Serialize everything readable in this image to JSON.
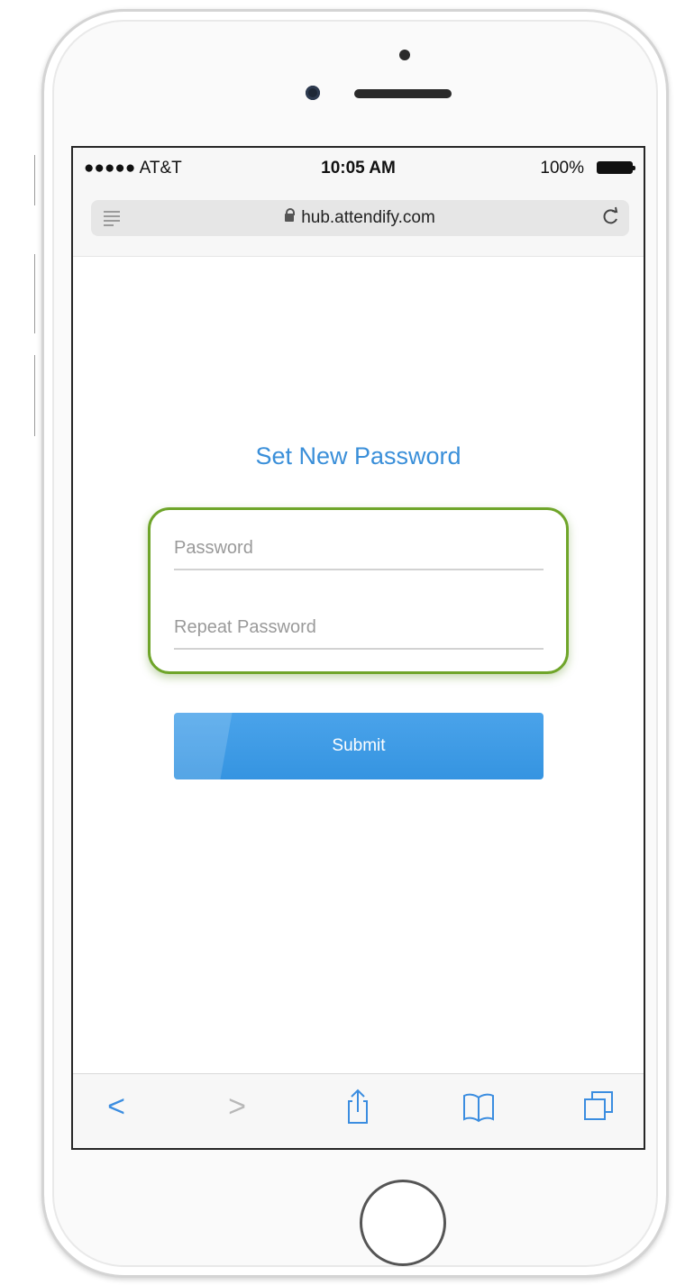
{
  "status_bar": {
    "carrier": "●●●●● AT&T",
    "time": "10:05 AM",
    "battery": "100%"
  },
  "browser": {
    "url": "hub.attendify.com",
    "reload_glyph": "C"
  },
  "form": {
    "title": "Set New Password",
    "password_placeholder": "Password",
    "repeat_placeholder": "Repeat Password",
    "submit_label": "Submit"
  },
  "toolbar": {
    "back_glyph": "<",
    "forward_glyph": ">"
  },
  "icons": {
    "reader": "reader-mode-icon",
    "lock": "lock-icon",
    "reload": "reload-icon",
    "share": "share-icon",
    "bookmarks": "bookmarks-icon",
    "tabs": "tabs-icon"
  },
  "colors": {
    "accent": "#3a8fd9",
    "button": "#3d9be6",
    "highlight": "#6fa52a",
    "forward_disabled": "#b8b8b8"
  }
}
